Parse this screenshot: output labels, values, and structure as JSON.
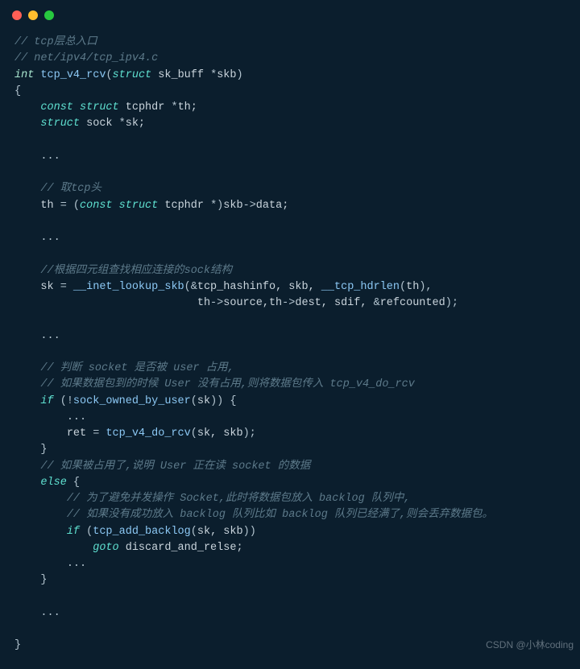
{
  "watermark": "CSDN @小林coding",
  "lines": [
    {
      "indent": 0,
      "tokens": [
        {
          "c": "cm",
          "t": "// tcp层总入口"
        }
      ]
    },
    {
      "indent": 0,
      "tokens": [
        {
          "c": "cm",
          "t": "// net/ipv4/tcp_ipv4.c"
        }
      ]
    },
    {
      "indent": 0,
      "tokens": [
        {
          "c": "ty",
          "t": "int"
        },
        {
          "c": "tx",
          "t": " "
        },
        {
          "c": "fn",
          "t": "tcp_v4_rcv"
        },
        {
          "c": "op",
          "t": "("
        },
        {
          "c": "kw",
          "t": "struct"
        },
        {
          "c": "tx",
          "t": " "
        },
        {
          "c": "tx",
          "t": "sk_buff "
        },
        {
          "c": "op",
          "t": "*"
        },
        {
          "c": "tx",
          "t": "skb"
        },
        {
          "c": "op",
          "t": ")"
        }
      ]
    },
    {
      "indent": 0,
      "tokens": [
        {
          "c": "op",
          "t": "{"
        }
      ]
    },
    {
      "indent": 1,
      "tokens": [
        {
          "c": "kw",
          "t": "const"
        },
        {
          "c": "tx",
          "t": " "
        },
        {
          "c": "kw",
          "t": "struct"
        },
        {
          "c": "tx",
          "t": " tcphdr "
        },
        {
          "c": "op",
          "t": "*"
        },
        {
          "c": "tx",
          "t": "th;"
        }
      ]
    },
    {
      "indent": 1,
      "tokens": [
        {
          "c": "kw",
          "t": "struct"
        },
        {
          "c": "tx",
          "t": " sock "
        },
        {
          "c": "op",
          "t": "*"
        },
        {
          "c": "tx",
          "t": "sk;"
        }
      ]
    },
    {
      "indent": 0,
      "tokens": [
        {
          "c": "tx",
          "t": " "
        }
      ]
    },
    {
      "indent": 1,
      "tokens": [
        {
          "c": "op",
          "t": "..."
        }
      ]
    },
    {
      "indent": 0,
      "tokens": [
        {
          "c": "tx",
          "t": " "
        }
      ]
    },
    {
      "indent": 1,
      "tokens": [
        {
          "c": "cm",
          "t": "// 取tcp头"
        }
      ]
    },
    {
      "indent": 1,
      "tokens": [
        {
          "c": "tx",
          "t": "th "
        },
        {
          "c": "op",
          "t": "= ("
        },
        {
          "c": "kw",
          "t": "const"
        },
        {
          "c": "tx",
          "t": " "
        },
        {
          "c": "kw",
          "t": "struct"
        },
        {
          "c": "tx",
          "t": " tcphdr "
        },
        {
          "c": "op",
          "t": "*)"
        },
        {
          "c": "tx",
          "t": "skb"
        },
        {
          "c": "op",
          "t": "->"
        },
        {
          "c": "tx",
          "t": "data;"
        }
      ]
    },
    {
      "indent": 0,
      "tokens": [
        {
          "c": "tx",
          "t": " "
        }
      ]
    },
    {
      "indent": 1,
      "tokens": [
        {
          "c": "op",
          "t": "..."
        }
      ]
    },
    {
      "indent": 0,
      "tokens": [
        {
          "c": "tx",
          "t": " "
        }
      ]
    },
    {
      "indent": 1,
      "tokens": [
        {
          "c": "cm",
          "t": "//根据四元组查找相应连接的sock结构"
        }
      ]
    },
    {
      "indent": 1,
      "tokens": [
        {
          "c": "tx",
          "t": "sk "
        },
        {
          "c": "op",
          "t": "= "
        },
        {
          "c": "fn",
          "t": "__inet_lookup_skb"
        },
        {
          "c": "op",
          "t": "(&"
        },
        {
          "c": "tx",
          "t": "tcp_hashinfo, skb, "
        },
        {
          "c": "fn",
          "t": "__tcp_hdrlen"
        },
        {
          "c": "op",
          "t": "("
        },
        {
          "c": "tx",
          "t": "th"
        },
        {
          "c": "op",
          "t": "),"
        }
      ]
    },
    {
      "indent": 1,
      "tokens": [
        {
          "c": "tx",
          "t": "                        th"
        },
        {
          "c": "op",
          "t": "->"
        },
        {
          "c": "tx",
          "t": "source,th"
        },
        {
          "c": "op",
          "t": "->"
        },
        {
          "c": "tx",
          "t": "dest, sdif, "
        },
        {
          "c": "op",
          "t": "&"
        },
        {
          "c": "tx",
          "t": "refcounted"
        },
        {
          "c": "op",
          "t": ");"
        }
      ]
    },
    {
      "indent": 0,
      "tokens": [
        {
          "c": "tx",
          "t": " "
        }
      ]
    },
    {
      "indent": 1,
      "tokens": [
        {
          "c": "op",
          "t": "..."
        }
      ]
    },
    {
      "indent": 0,
      "tokens": [
        {
          "c": "tx",
          "t": " "
        }
      ]
    },
    {
      "indent": 1,
      "tokens": [
        {
          "c": "cm",
          "t": "// 判断 socket 是否被 user 占用,"
        }
      ]
    },
    {
      "indent": 1,
      "tokens": [
        {
          "c": "cm",
          "t": "// 如果数据包到的时候 User 没有占用,则将数据包传入 tcp_v4_do_rcv"
        }
      ]
    },
    {
      "indent": 1,
      "tokens": [
        {
          "c": "kw",
          "t": "if"
        },
        {
          "c": "tx",
          "t": " "
        },
        {
          "c": "op",
          "t": "(!"
        },
        {
          "c": "fn",
          "t": "sock_owned_by_user"
        },
        {
          "c": "op",
          "t": "("
        },
        {
          "c": "tx",
          "t": "sk"
        },
        {
          "c": "op",
          "t": ")) {"
        }
      ]
    },
    {
      "indent": 2,
      "tokens": [
        {
          "c": "op",
          "t": "..."
        }
      ]
    },
    {
      "indent": 2,
      "tokens": [
        {
          "c": "tx",
          "t": "ret "
        },
        {
          "c": "op",
          "t": "= "
        },
        {
          "c": "fn",
          "t": "tcp_v4_do_rcv"
        },
        {
          "c": "op",
          "t": "("
        },
        {
          "c": "tx",
          "t": "sk, skb"
        },
        {
          "c": "op",
          "t": ");"
        }
      ]
    },
    {
      "indent": 1,
      "tokens": [
        {
          "c": "op",
          "t": "}"
        }
      ]
    },
    {
      "indent": 1,
      "tokens": [
        {
          "c": "cm",
          "t": "// 如果被占用了,说明 User 正在读 socket 的数据"
        }
      ]
    },
    {
      "indent": 1,
      "tokens": [
        {
          "c": "kw",
          "t": "else"
        },
        {
          "c": "tx",
          "t": " "
        },
        {
          "c": "op",
          "t": "{"
        }
      ]
    },
    {
      "indent": 2,
      "tokens": [
        {
          "c": "cm",
          "t": "// 为了避免并发操作 Socket,此时将数据包放入 backlog 队列中,"
        }
      ]
    },
    {
      "indent": 2,
      "tokens": [
        {
          "c": "cm",
          "t": "// 如果没有成功放入 backlog 队列比如 backlog 队列已经满了,则会丢弃数据包。"
        }
      ]
    },
    {
      "indent": 2,
      "tokens": [
        {
          "c": "kw",
          "t": "if"
        },
        {
          "c": "tx",
          "t": " "
        },
        {
          "c": "op",
          "t": "("
        },
        {
          "c": "fn",
          "t": "tcp_add_backlog"
        },
        {
          "c": "op",
          "t": "("
        },
        {
          "c": "tx",
          "t": "sk, skb"
        },
        {
          "c": "op",
          "t": "))"
        }
      ]
    },
    {
      "indent": 3,
      "tokens": [
        {
          "c": "kw",
          "t": "goto"
        },
        {
          "c": "tx",
          "t": " discard_and_relse;"
        }
      ]
    },
    {
      "indent": 2,
      "tokens": [
        {
          "c": "op",
          "t": "..."
        }
      ]
    },
    {
      "indent": 1,
      "tokens": [
        {
          "c": "op",
          "t": "}"
        }
      ]
    },
    {
      "indent": 0,
      "tokens": [
        {
          "c": "tx",
          "t": " "
        }
      ]
    },
    {
      "indent": 1,
      "tokens": [
        {
          "c": "op",
          "t": "..."
        }
      ]
    },
    {
      "indent": 0,
      "tokens": [
        {
          "c": "tx",
          "t": " "
        }
      ]
    },
    {
      "indent": 0,
      "tokens": [
        {
          "c": "op",
          "t": "}"
        }
      ]
    }
  ]
}
